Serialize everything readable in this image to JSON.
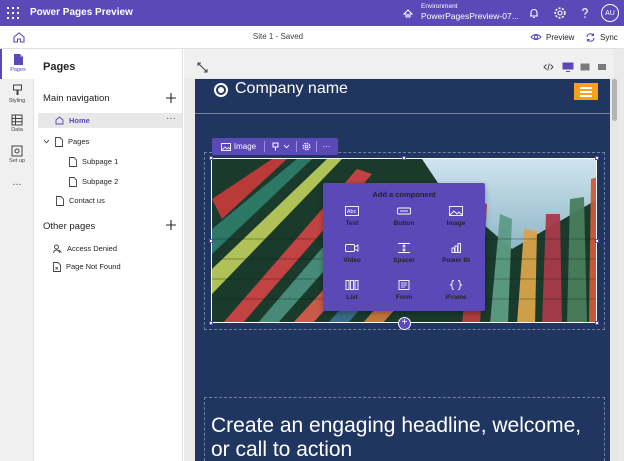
{
  "app": {
    "title": "Power Pages Preview"
  },
  "environment": {
    "label": "Environment",
    "value": "PowerPagesPreview-07..."
  },
  "user": {
    "initials": "AU"
  },
  "subbar": {
    "site_status": "Site 1 - Saved",
    "preview_label": "Preview",
    "sync_label": "Sync"
  },
  "rail": {
    "items": [
      {
        "label": "Pages",
        "icon": "page-icon",
        "active": true
      },
      {
        "label": "Styling",
        "icon": "paintbrush-icon"
      },
      {
        "label": "Data",
        "icon": "table-icon"
      },
      {
        "label": "Set up",
        "icon": "setup-icon"
      }
    ],
    "more": "..."
  },
  "panel": {
    "title": "Pages",
    "main_nav_title": "Main navigation",
    "main_nav": [
      {
        "label": "Home"
      },
      {
        "label": "Pages"
      },
      {
        "label": "Subpage 1"
      },
      {
        "label": "Subpage 2"
      },
      {
        "label": "Contact us"
      }
    ],
    "other_title": "Other pages",
    "other_pages": [
      {
        "label": "Access Denied"
      },
      {
        "label": "Page Not Found"
      }
    ],
    "more": "···"
  },
  "site": {
    "company_name": "Company name",
    "headline": "Create an engaging headline, welcome, or call to action"
  },
  "toolbar": {
    "image_label": "Image",
    "more": "···"
  },
  "add_component": {
    "title": "Add a component",
    "items": [
      {
        "label": "Text",
        "icon": "text-icon"
      },
      {
        "label": "Button",
        "icon": "button-icon"
      },
      {
        "label": "Image",
        "icon": "image-icon"
      },
      {
        "label": "Video",
        "icon": "video-icon"
      },
      {
        "label": "Spacer",
        "icon": "spacer-icon"
      },
      {
        "label": "Power BI",
        "icon": "powerbi-icon"
      },
      {
        "label": "List",
        "icon": "list-icon"
      },
      {
        "label": "Form",
        "icon": "form-icon"
      },
      {
        "label": "iFrame",
        "icon": "iframe-icon"
      }
    ],
    "plus": "+"
  },
  "colors": {
    "accent": "#5b49b8",
    "site_bg": "#203660",
    "menu_button": "#f7a01d"
  }
}
